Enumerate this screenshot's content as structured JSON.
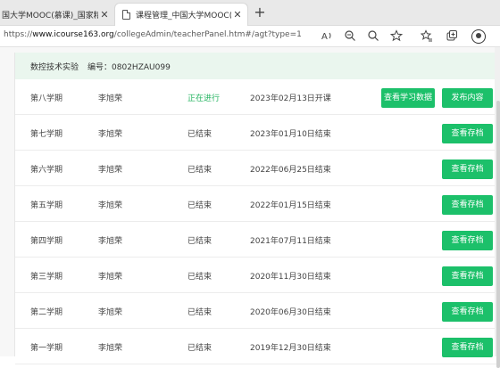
{
  "browser": {
    "tabs": [
      {
        "label": "国大学MOOC(慕课)_国家精品",
        "close": "✕"
      },
      {
        "label": "课程管理_中国大学MOOC(慕课)",
        "close": "✕"
      }
    ],
    "new_tab": "+",
    "url_prefix": "https://",
    "url_host": "www.icourse163.org",
    "url_path": "/collegeAdmin/teacherPanel.htm#/agt?type=1",
    "toolbar_icons": [
      "read-aloud-icon",
      "zoom-icon",
      "search-icon",
      "favorite-icon",
      "favorites-icon",
      "collections-icon",
      "extensions-icon"
    ]
  },
  "course": {
    "name": "数控技术实验",
    "code_label": "编号：",
    "code": "0802HZAU099"
  },
  "terms": [
    {
      "term": "第八学期",
      "teacher": "李旭荣",
      "status": "正在进行",
      "date": "2023年02月13日开课",
      "running": true,
      "buttons": [
        "查看学习数据",
        "发布内容"
      ]
    },
    {
      "term": "第七学期",
      "teacher": "李旭荣",
      "status": "已结束",
      "date": "2023年01月10日结束",
      "running": false,
      "buttons": [
        "查看存档"
      ]
    },
    {
      "term": "第六学期",
      "teacher": "李旭荣",
      "status": "已结束",
      "date": "2022年06月25日结束",
      "running": false,
      "buttons": [
        "查看存档"
      ]
    },
    {
      "term": "第五学期",
      "teacher": "李旭荣",
      "status": "已结束",
      "date": "2022年01月15日结束",
      "running": false,
      "buttons": [
        "查看存档"
      ]
    },
    {
      "term": "第四学期",
      "teacher": "李旭荣",
      "status": "已结束",
      "date": "2021年07月11日结束",
      "running": false,
      "buttons": [
        "查看存档"
      ]
    },
    {
      "term": "第三学期",
      "teacher": "李旭荣",
      "status": "已结束",
      "date": "2020年11月30日结束",
      "running": false,
      "buttons": [
        "查看存档"
      ]
    },
    {
      "term": "第二学期",
      "teacher": "李旭荣",
      "status": "已结束",
      "date": "2020年06月30日结束",
      "running": false,
      "buttons": [
        "查看存档"
      ]
    },
    {
      "term": "第一学期",
      "teacher": "李旭荣",
      "status": "已结束",
      "date": "2019年12月30日结束",
      "running": false,
      "buttons": [
        "查看存档"
      ]
    }
  ],
  "colors": {
    "accent": "#1cc06a",
    "running_text": "#21b35e",
    "header_bg": "#eaf6ee"
  }
}
